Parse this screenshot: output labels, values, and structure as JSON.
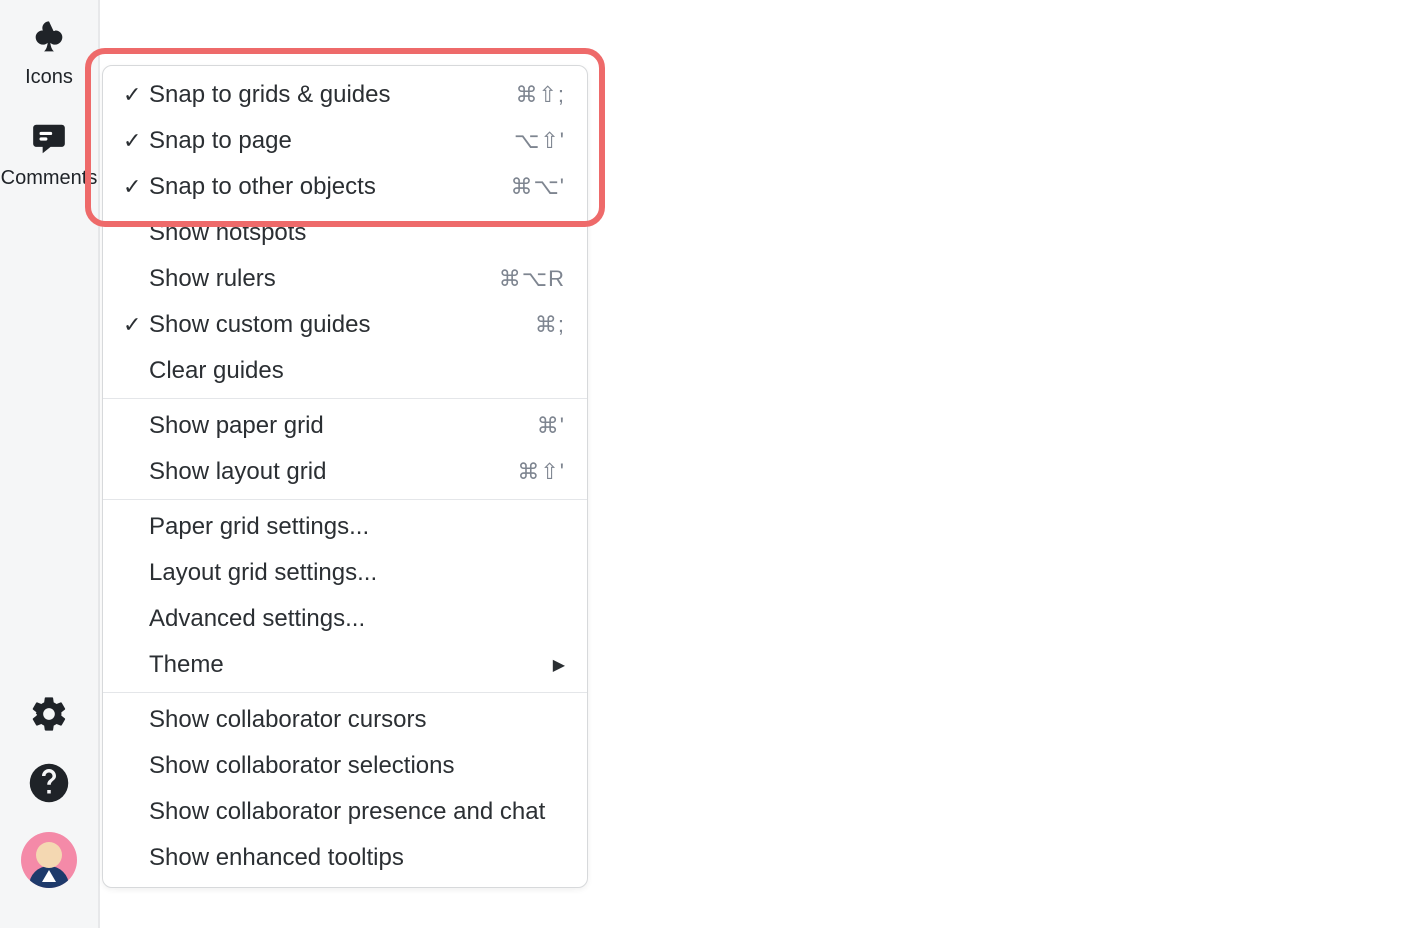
{
  "sidebar": {
    "icons_label": "Icons",
    "comments_label": "Comments"
  },
  "menu": {
    "groups": [
      [
        {
          "checked": true,
          "label": "Snap to grids & guides",
          "shortcut": "⌘⇧;"
        },
        {
          "checked": true,
          "label": "Snap to page",
          "shortcut": "⌥⇧'"
        },
        {
          "checked": true,
          "label": "Snap to other objects",
          "shortcut": "⌘⌥'"
        },
        {
          "checked": false,
          "label": "Show hotspots",
          "shortcut": ""
        },
        {
          "checked": false,
          "label": "Show rulers",
          "shortcut": "⌘⌥R"
        },
        {
          "checked": true,
          "label": "Show custom guides",
          "shortcut": "⌘;"
        },
        {
          "checked": false,
          "label": "Clear guides",
          "shortcut": ""
        }
      ],
      [
        {
          "checked": false,
          "label": "Show paper grid",
          "shortcut": "⌘'"
        },
        {
          "checked": false,
          "label": "Show layout grid",
          "shortcut": "⌘⇧'"
        }
      ],
      [
        {
          "checked": false,
          "label": "Paper grid settings...",
          "shortcut": ""
        },
        {
          "checked": false,
          "label": "Layout grid settings...",
          "shortcut": ""
        },
        {
          "checked": false,
          "label": "Advanced settings...",
          "shortcut": ""
        },
        {
          "checked": false,
          "label": "Theme",
          "shortcut": "",
          "submenu": true
        }
      ],
      [
        {
          "checked": false,
          "label": "Show collaborator cursors",
          "shortcut": ""
        },
        {
          "checked": false,
          "label": "Show collaborator selections",
          "shortcut": ""
        },
        {
          "checked": false,
          "label": "Show collaborator presence and chat",
          "shortcut": ""
        },
        {
          "checked": false,
          "label": "Show enhanced tooltips",
          "shortcut": ""
        }
      ]
    ]
  }
}
